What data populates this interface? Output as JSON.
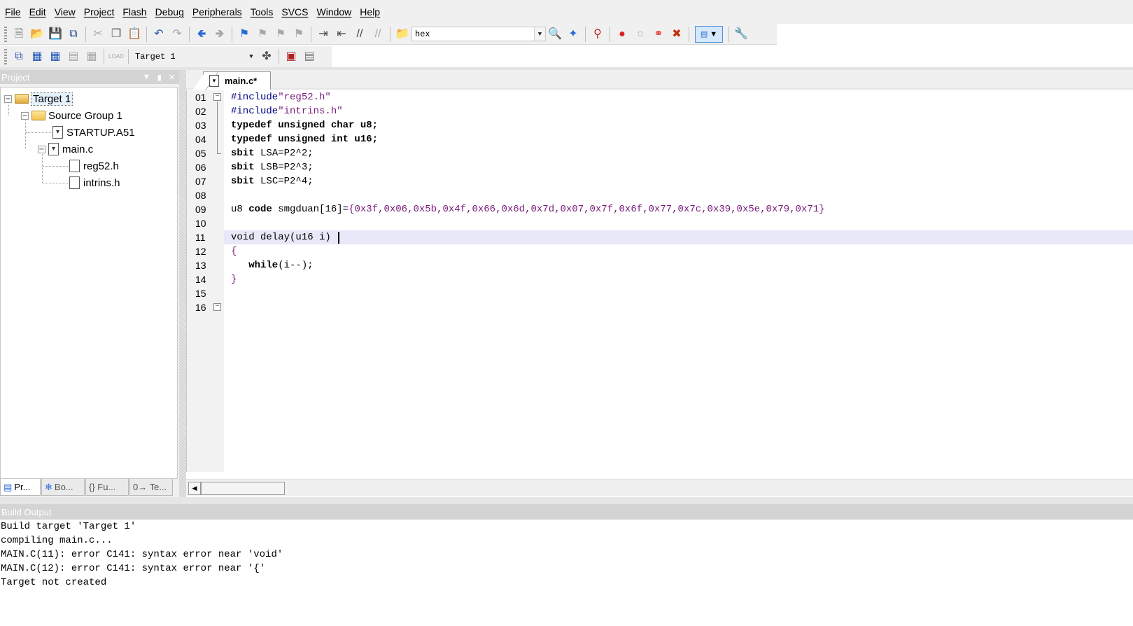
{
  "menu": [
    "File",
    "Edit",
    "View",
    "Project",
    "Flash",
    "Debug",
    "Peripherals",
    "Tools",
    "SVCS",
    "Window",
    "Help"
  ],
  "toolbar": {
    "find_combo_value": "hex",
    "target_combo_value": "Target 1",
    "load_label": "LOAD"
  },
  "project_panel": {
    "title": "Project",
    "tree": {
      "target": "Target 1",
      "group": "Source Group 1",
      "startup": "STARTUP.A51",
      "main": "main.c",
      "include1": "reg52.h",
      "include2": "intrins.h"
    },
    "tabs": [
      "Pr...",
      "Bo...",
      "{} Fu...",
      "0→ Te..."
    ]
  },
  "editor": {
    "tab_label": "main.c*",
    "line_numbers": [
      "01",
      "02",
      "03",
      "04",
      "05",
      "06",
      "07",
      "08",
      "09",
      "10",
      "11",
      "12",
      "13",
      "14",
      "15",
      "16"
    ],
    "current_line": 11,
    "code": {
      "l1_pre": "#include",
      "l1_str": "\"reg52.h\"",
      "l2_pre": "#include",
      "l2_str": "\"intrins.h\"",
      "l3": "typedef unsigned char u8;",
      "l4": "typedef unsigned int u16;",
      "l5_kw": "sbit",
      "l5_rest": " LSA=P2^2;",
      "l6_kw": "sbit",
      "l6_rest": " LSB=P2^3;",
      "l7_kw": "sbit",
      "l7_rest": " LSC=P2^4;",
      "l9_a": "u8 ",
      "l9_kw": "code",
      "l9_b": " smgduan[16]=",
      "l9_vals": "{0x3f,0x06,0x5b,0x4f,0x66,0x6d,0x7d,0x07,0x7f,0x6f,0x77,0x7c,0x39,0x5e,0x79,0x71}",
      "l11": "void delay(u16 i) ",
      "l12": "{",
      "l13_kw": "   while",
      "l13_rest": "(i--);",
      "l14": "}"
    }
  },
  "build_output": {
    "title": "Build Output",
    "lines": [
      "Build target 'Target 1'",
      "compiling main.c...",
      "MAIN.C(11): error C141: syntax error near 'void'",
      "MAIN.C(12): error C141: syntax error near '{'",
      "Target not created"
    ]
  },
  "icons": [
    "new-file-icon",
    "open-folder-icon",
    "save-icon",
    "save-all-icon",
    "cut-icon",
    "copy-icon",
    "paste-icon",
    "undo-icon",
    "redo-icon",
    "nav-back-icon",
    "nav-forward-icon",
    "bookmark-icon",
    "indent-icon",
    "outdent-icon",
    "comment-icon",
    "uncomment-icon",
    "find-in-files-icon",
    "debug-start-icon",
    "breakpoint-icon",
    "settings-icon",
    "build-icon",
    "rebuild-icon",
    "translate-icon",
    "options-icon",
    "manage-icon"
  ]
}
